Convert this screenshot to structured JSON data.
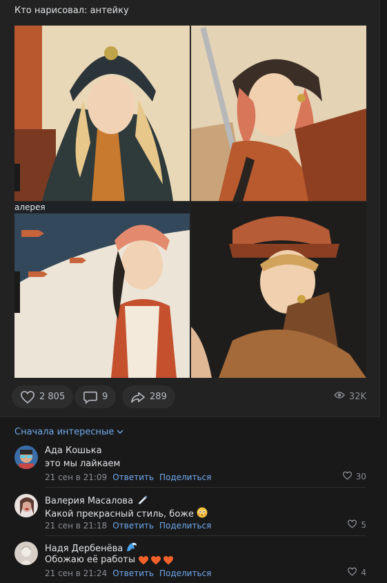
{
  "post": {
    "text": "Кто нарисовал: антейку",
    "gallery_caption": "алерея"
  },
  "actions": {
    "likes": "2 805",
    "comments": "9",
    "shares": "289",
    "views": "32K"
  },
  "comments_section": {
    "sort_label": "Сначала интересные"
  },
  "comments": [
    {
      "author": "Ада Кошька",
      "text": "это мы лайкаем",
      "time": "21 сен в 21:09",
      "reply": "Ответить",
      "share": "Поделиться",
      "likes": "30"
    },
    {
      "author": "Валерия Масалова",
      "text": "Какой прекрасный стиль, боже",
      "time": "21 сен в 21:18",
      "reply": "Ответить",
      "share": "Поделиться",
      "likes": "5"
    },
    {
      "author": "Надя Дербенёва",
      "text": "Обожаю её работы",
      "time": "21 сен в 21:24",
      "reply": "Ответить",
      "share": "Поделиться",
      "likes": "4"
    }
  ],
  "colors": {
    "link": "#71aaeb",
    "muted": "#8b8e93",
    "heart": "#e64646"
  }
}
